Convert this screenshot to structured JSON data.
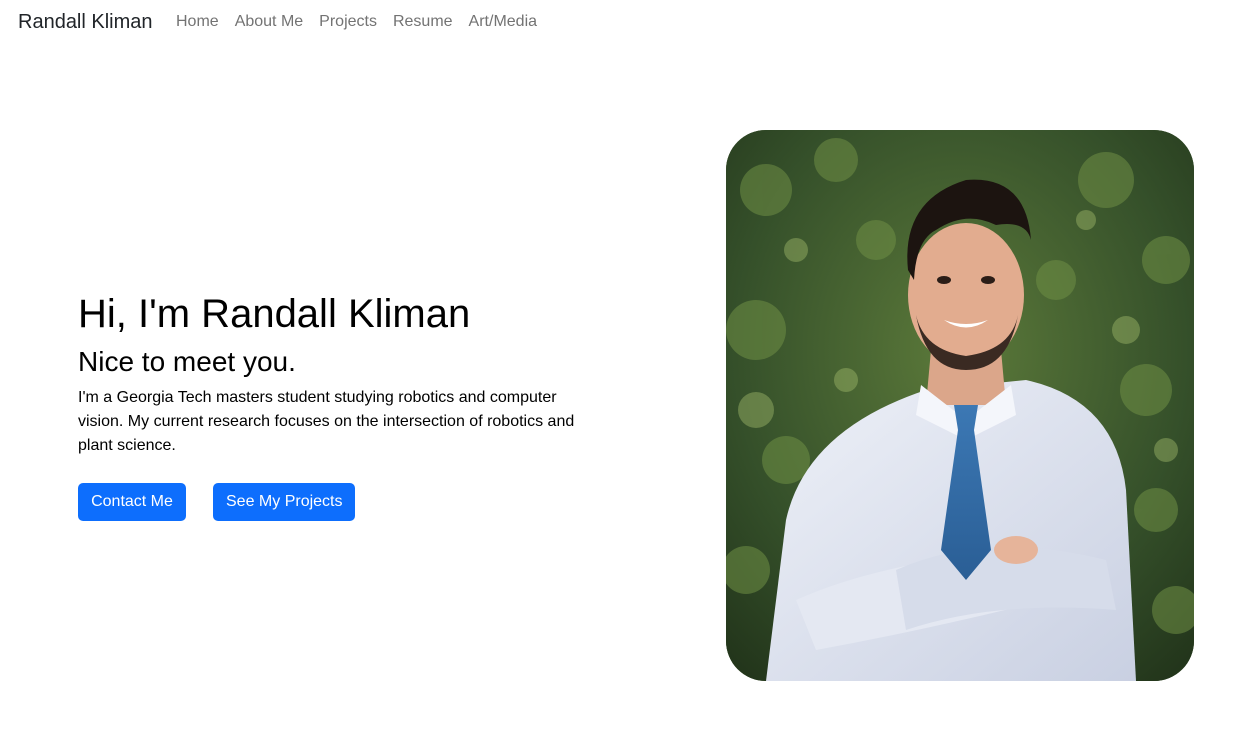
{
  "navbar": {
    "brand": "Randall Kliman",
    "links": [
      "Home",
      "About Me",
      "Projects",
      "Resume",
      "Art/Media"
    ]
  },
  "hero": {
    "title": "Hi, I'm Randall Kliman",
    "subtitle": "Nice to meet you.",
    "body": "I'm a Georgia Tech masters student studying robotics and computer vision. My current research focuses on the intersection of robotics and plant science.",
    "buttons": {
      "contact": "Contact Me",
      "projects": "See My Projects"
    }
  },
  "colors": {
    "primary": "#0d6efd",
    "nav_link": "#737373",
    "foliage": "#3d5a2a"
  }
}
